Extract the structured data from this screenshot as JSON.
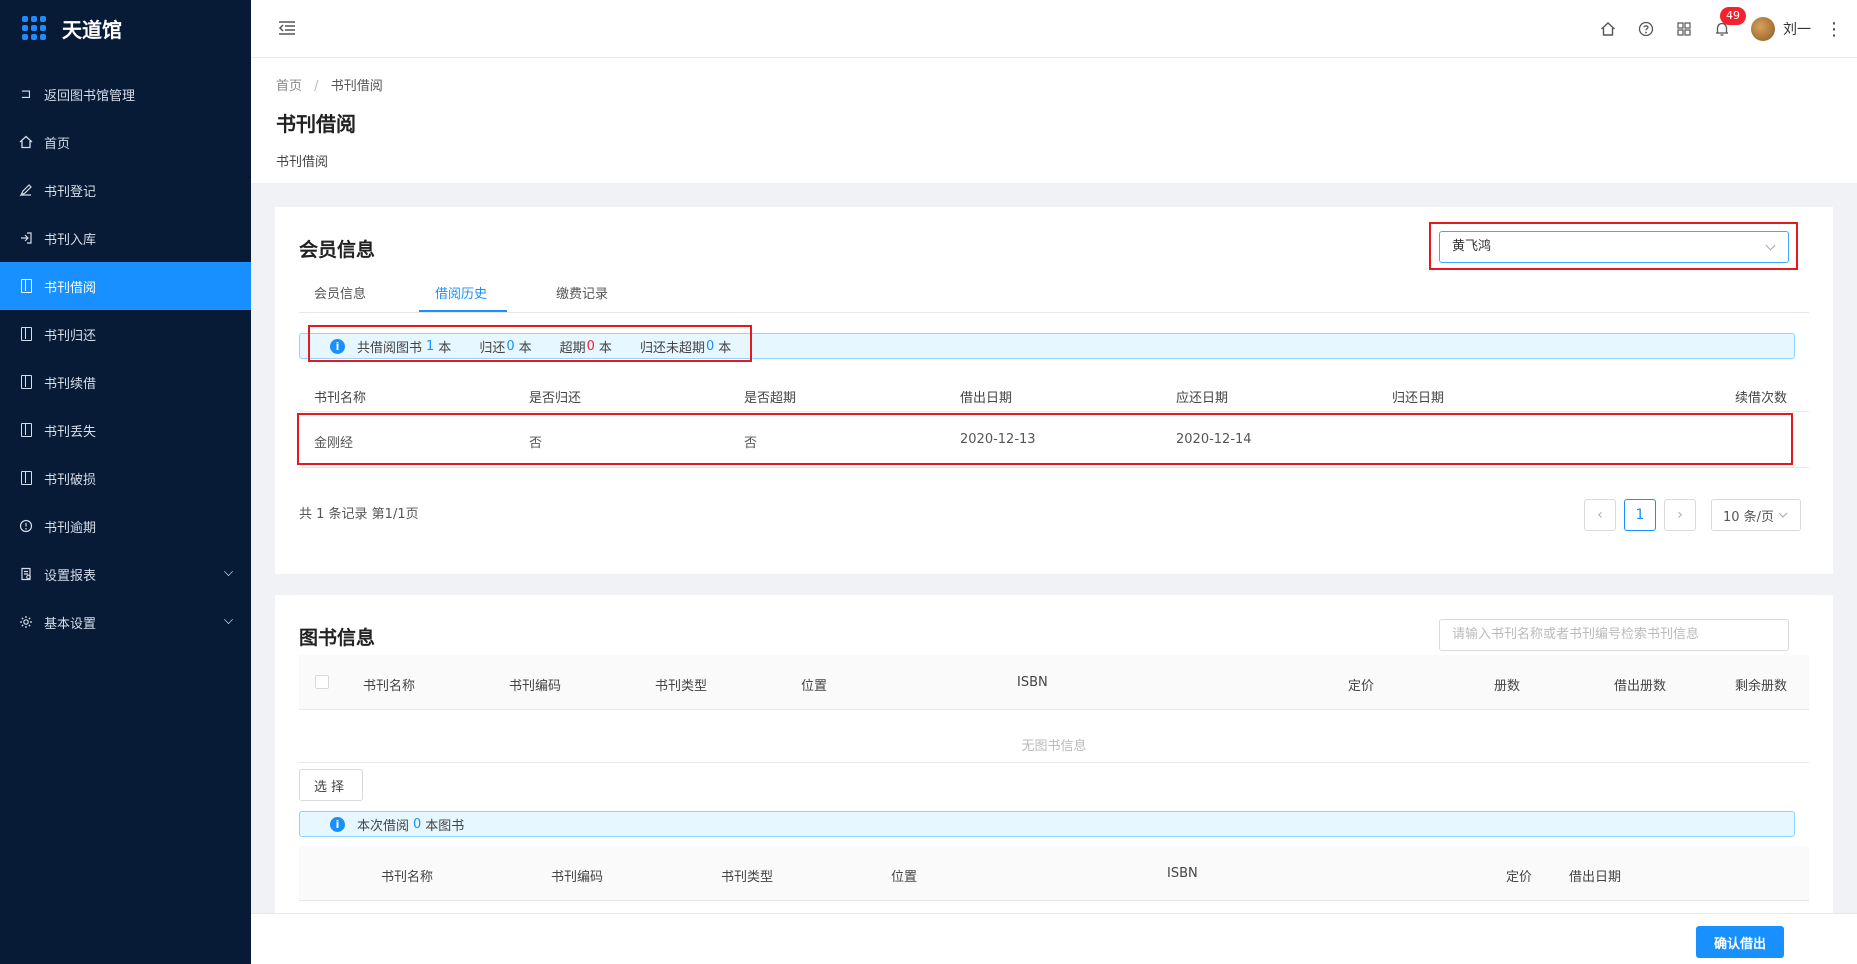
{
  "app": {
    "name": "天道馆"
  },
  "sidebar": {
    "items": [
      {
        "label": "返回图书馆管理",
        "icon": "return-icon"
      },
      {
        "label": "首页",
        "icon": "home-icon"
      },
      {
        "label": "书刊登记",
        "icon": "pen-icon"
      },
      {
        "label": "书刊入库",
        "icon": "import-icon"
      },
      {
        "label": "书刊借阅",
        "icon": "document-icon",
        "active": true
      },
      {
        "label": "书刊归还",
        "icon": "document-icon"
      },
      {
        "label": "书刊续借",
        "icon": "document-icon"
      },
      {
        "label": "书刊丢失",
        "icon": "document-icon"
      },
      {
        "label": "书刊破损",
        "icon": "document-icon"
      },
      {
        "label": "书刊逾期",
        "icon": "clock-icon"
      },
      {
        "label": "设置报表",
        "icon": "report-icon",
        "expandable": true
      },
      {
        "label": "基本设置",
        "icon": "settings-icon",
        "expandable": true
      }
    ]
  },
  "header": {
    "notification_count": "49",
    "user_name": "刘一"
  },
  "breadcrumb": {
    "home": "首页",
    "separator": "/",
    "current": "书刊借阅"
  },
  "page": {
    "title": "书刊借阅",
    "subtitle": "书刊借阅"
  },
  "member": {
    "title": "会员信息",
    "selected_member": "黄飞鸿",
    "tabs": [
      "会员信息",
      "借阅历史",
      "缴费记录"
    ],
    "active_tab": 1,
    "summary": {
      "total_label": "共借阅图书",
      "total_value": "1",
      "unit": "本",
      "returned_label": "归还",
      "returned_value": "0",
      "overdue_label": "超期",
      "overdue_value": "0",
      "unreturned_overdue_label": "归还未超期",
      "unreturned_overdue_value": "0"
    },
    "table": {
      "columns": [
        "书刊名称",
        "是否归还",
        "是否超期",
        "借出日期",
        "应还日期",
        "归还日期",
        "续借次数"
      ],
      "rows": [
        [
          "金刚经",
          "否",
          "否",
          "2020-12-13",
          "2020-12-14",
          "",
          ""
        ]
      ]
    },
    "pagination": {
      "total_text": "共 1 条记录 第1/1页",
      "current_page": "1",
      "page_size": "10 条/页"
    }
  },
  "books": {
    "title": "图书信息",
    "search_placeholder": "请输入书刊名称或者书刊编号检索书刊信息",
    "columns": [
      "书刊名称",
      "书刊编码",
      "书刊类型",
      "位置",
      "ISBN",
      "定价",
      "册数",
      "借出册数",
      "剩余册数"
    ],
    "empty_text": "无图书信息",
    "select_button": "选择",
    "borrow_info": {
      "prefix": "本次借阅",
      "count": "0",
      "suffix": "本图书"
    },
    "borrow_columns": [
      "书刊名称",
      "书刊编码",
      "书刊类型",
      "位置",
      "ISBN",
      "定价",
      "借出日期"
    ]
  },
  "footer": {
    "confirm_button": "确认借出"
  },
  "colors": {
    "primary": "#1890ff",
    "sidebar_bg": "#071a36",
    "danger": "#f5222d",
    "annotation": "#e8191c"
  }
}
